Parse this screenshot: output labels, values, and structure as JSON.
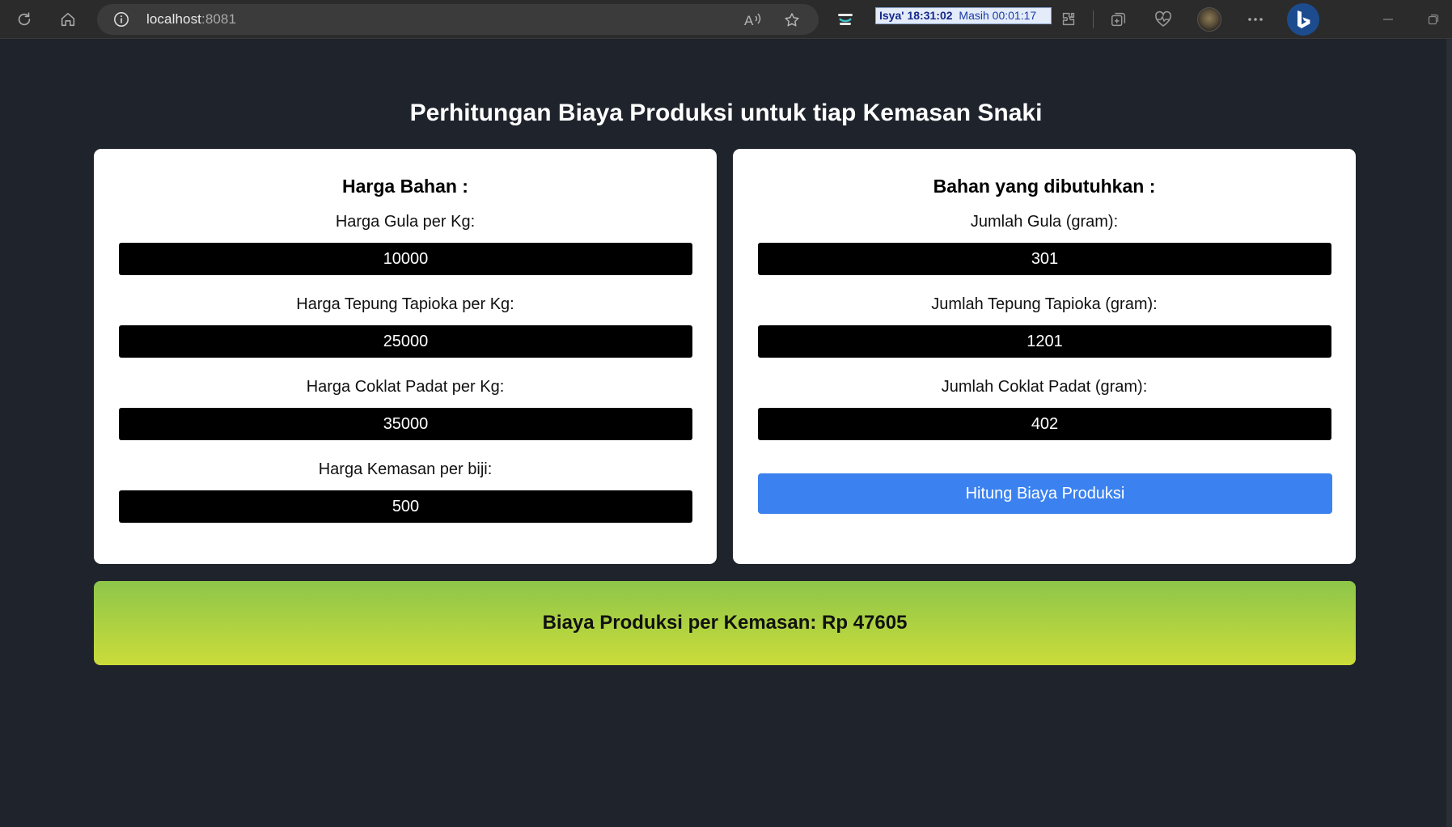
{
  "browser": {
    "url_host": "localhost",
    "url_port": ":8081",
    "prayer_widget": {
      "prayer": "Isya'",
      "time": "18:31:02",
      "masih_label": "Masih",
      "remaining": "00:01:17"
    },
    "icons": [
      "refresh-icon",
      "home-icon",
      "info-icon",
      "read-aloud-icon",
      "favorite-star-icon",
      "extension-icon",
      "puzzle-icon",
      "collections-icon",
      "heart-pulse-icon",
      "avatar",
      "more-icon",
      "bing-icon",
      "minimize-icon",
      "restore-icon"
    ]
  },
  "page": {
    "title": "Perhitungan Biaya Produksi untuk tiap Kemasan Snaki"
  },
  "harga_bahan": {
    "heading": "Harga Bahan :",
    "fields": [
      {
        "label": "Harga Gula per Kg:",
        "value": "10000"
      },
      {
        "label": "Harga Tepung Tapioka per Kg:",
        "value": "25000"
      },
      {
        "label": "Harga Coklat Padat per Kg:",
        "value": "35000"
      },
      {
        "label": "Harga Kemasan per biji:",
        "value": "500"
      }
    ]
  },
  "bahan_dibutuhkan": {
    "heading": "Bahan yang dibutuhkan :",
    "fields": [
      {
        "label": "Jumlah Gula (gram):",
        "value": "301"
      },
      {
        "label": "Jumlah Tepung Tapioka (gram):",
        "value": "1201"
      },
      {
        "label": "Jumlah Coklat Padat (gram):",
        "value": "402"
      }
    ],
    "button_label": "Hitung Biaya Produksi"
  },
  "result": {
    "text": "Biaya Produksi per Kemasan: Rp 47605"
  },
  "colors": {
    "background": "#1f232b",
    "card": "#ffffff",
    "input": "#000000",
    "button": "#3b82f0",
    "result_gradient_top": "#8dc64a",
    "result_gradient_bottom": "#cbdc3a"
  }
}
